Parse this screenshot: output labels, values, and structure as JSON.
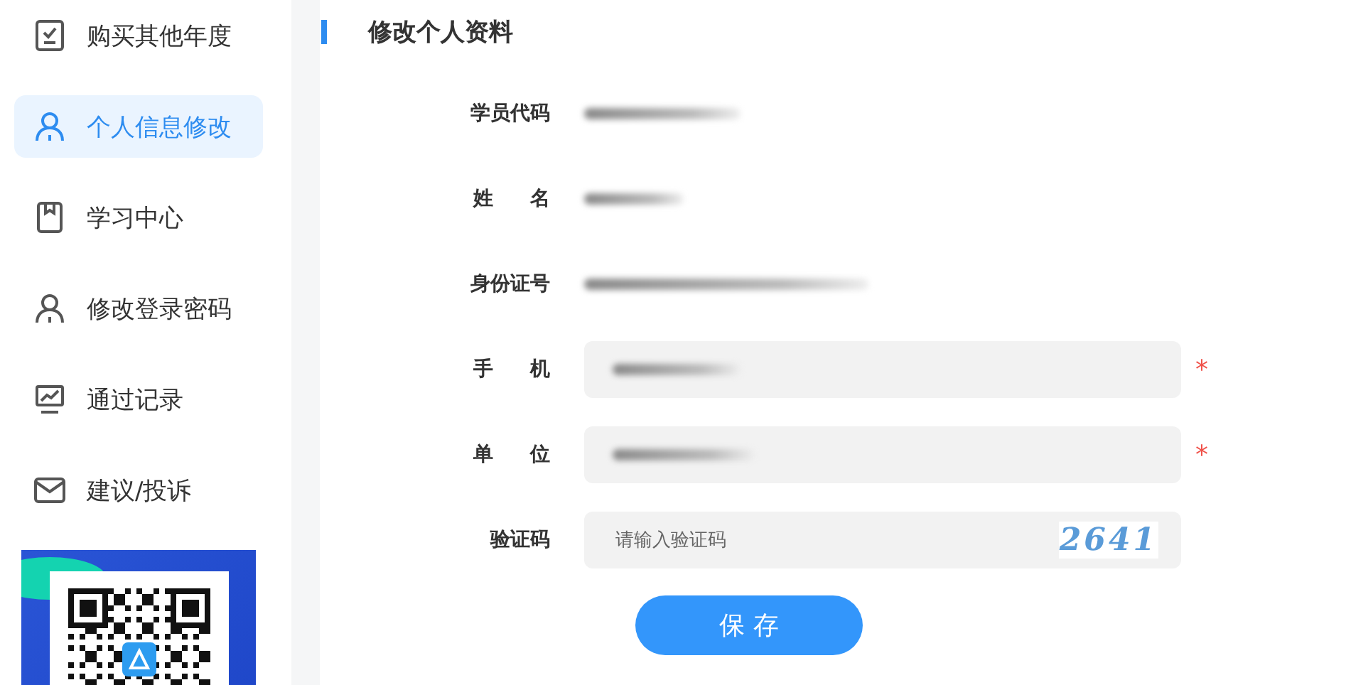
{
  "sidebar": {
    "items": [
      {
        "label": "购买其他年度",
        "selected": false
      },
      {
        "label": "个人信息修改",
        "selected": true
      },
      {
        "label": "学习中心",
        "selected": false
      },
      {
        "label": "修改登录密码",
        "selected": false
      },
      {
        "label": "通过记录",
        "selected": false
      },
      {
        "label": "建议/投诉",
        "selected": false
      }
    ],
    "banner": {
      "kind": "qr"
    }
  },
  "form": {
    "title": "修改个人资料",
    "fields": [
      {
        "label": "学员代码",
        "kind": "static"
      },
      {
        "label": "姓 名",
        "kind": "static"
      },
      {
        "label": "身份证号",
        "kind": "static"
      },
      {
        "label": "手 机",
        "kind": "input",
        "required_mark": "*"
      },
      {
        "label": "单 位",
        "kind": "input",
        "required_mark": "*"
      },
      {
        "label": "验证码",
        "kind": "captcha",
        "placeholder": "请输入验证码",
        "captcha": "2641"
      }
    ],
    "submit": "保 存"
  }
}
